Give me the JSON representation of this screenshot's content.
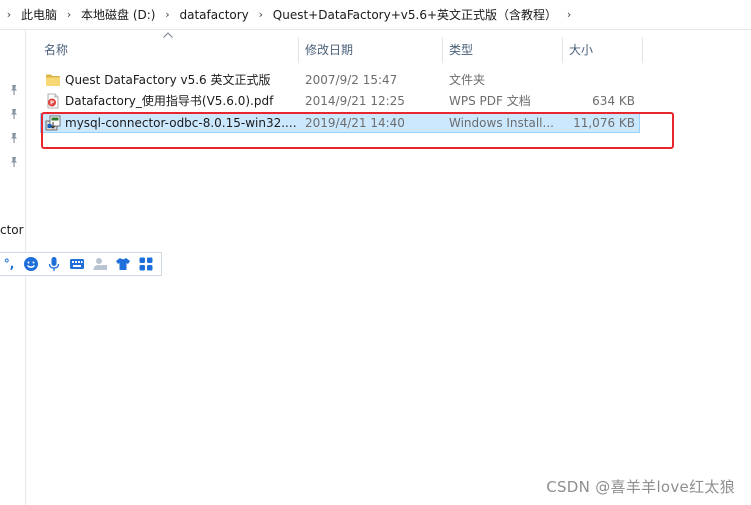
{
  "breadcrumb": {
    "items": [
      "此电脑",
      "本地磁盘 (D:)",
      "datafactory",
      "Quest+DataFactory+v5.6+英文正式版（含教程）"
    ],
    "separator": "›"
  },
  "columns": {
    "name": "名称",
    "modified": "修改日期",
    "type": "类型",
    "size": "大小"
  },
  "files": [
    {
      "name": "Quest DataFactory v5.6 英文正式版",
      "modified": "2007/9/2 15:47",
      "type": "文件夹",
      "size": "",
      "icon": "folder-icon",
      "selected": false
    },
    {
      "name": "Datafactory_使用指导书(V5.6.0).pdf",
      "modified": "2014/9/21 12:25",
      "type": "WPS PDF 文档",
      "size": "634 KB",
      "icon": "pdf-icon",
      "selected": false
    },
    {
      "name": "mysql-connector-odbc-8.0.15-win32....",
      "modified": "2019/4/21 14:40",
      "type": "Windows Install...",
      "size": "11,076 KB",
      "icon": "msi-installer-icon",
      "selected": true
    }
  ],
  "nav": {
    "partial_label": "ctor"
  },
  "ime_toolbar": {
    "punctuation": "°,"
  },
  "watermark": "CSDN @喜羊羊love红太狼",
  "colors": {
    "selection_bg": "#cce8ff",
    "selection_border": "#99d1ff",
    "highlight": "#e8262d",
    "ime_blue": "#1e6fd9",
    "folder": "#f8d775"
  }
}
